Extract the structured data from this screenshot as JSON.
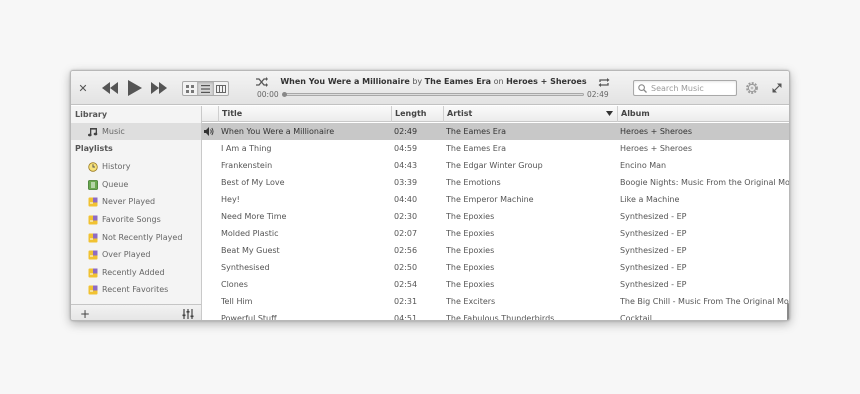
{
  "player": {
    "now_playing_title": "When You Were a Millionaire",
    "now_playing_by": "by",
    "now_playing_artist": "The Eames Era",
    "now_playing_on": "on",
    "now_playing_album": "Heroes + Sheroes",
    "time_elapsed": "00:00",
    "time_total": "02:49",
    "progress": 0.0
  },
  "search": {
    "placeholder": "Search Music",
    "value": ""
  },
  "sidebar": {
    "library_heading": "Library",
    "library_items": [
      {
        "label": "Music",
        "icon": "music-note-icon"
      }
    ],
    "playlists_heading": "Playlists",
    "playlist_items": [
      {
        "label": "History",
        "icon": "history-icon"
      },
      {
        "label": "Queue",
        "icon": "queue-icon"
      },
      {
        "label": "Never Played",
        "icon": "smart-playlist-icon"
      },
      {
        "label": "Favorite Songs",
        "icon": "smart-playlist-icon"
      },
      {
        "label": "Not Recently Played",
        "icon": "smart-playlist-icon"
      },
      {
        "label": "Over Played",
        "icon": "smart-playlist-icon"
      },
      {
        "label": "Recently Added",
        "icon": "smart-playlist-icon"
      },
      {
        "label": "Recent Favorites",
        "icon": "smart-playlist-icon"
      }
    ],
    "add_label": "+"
  },
  "table": {
    "columns": [
      "Title",
      "Length",
      "Artist",
      "Album"
    ],
    "sort_column": "Artist",
    "rows": [
      {
        "title": "When You Were a Millionaire",
        "length": "02:49",
        "artist": "The Eames Era",
        "album": "Heroes + Sheroes",
        "playing": true
      },
      {
        "title": "I Am a Thing",
        "length": "04:59",
        "artist": "The Eames Era",
        "album": "Heroes + Sheroes"
      },
      {
        "title": "Frankenstein",
        "length": "04:43",
        "artist": "The Edgar Winter Group",
        "album": "Encino Man"
      },
      {
        "title": "Best of My Love",
        "length": "03:39",
        "artist": "The Emotions",
        "album": "Boogie Nights: Music From the Original Motion"
      },
      {
        "title": "Hey!",
        "length": "04:40",
        "artist": "The Emperor Machine",
        "album": "Like a Machine"
      },
      {
        "title": "Need More Time",
        "length": "02:30",
        "artist": "The Epoxies",
        "album": "Synthesized - EP"
      },
      {
        "title": "Molded Plastic",
        "length": "02:07",
        "artist": "The Epoxies",
        "album": "Synthesized - EP"
      },
      {
        "title": "Beat My Guest",
        "length": "02:56",
        "artist": "The Epoxies",
        "album": "Synthesized - EP"
      },
      {
        "title": "Synthesised",
        "length": "02:50",
        "artist": "The Epoxies",
        "album": "Synthesized - EP"
      },
      {
        "title": "Clones",
        "length": "02:54",
        "artist": "The Epoxies",
        "album": "Synthesized - EP"
      },
      {
        "title": "Tell Him",
        "length": "02:31",
        "artist": "The Exciters",
        "album": "The Big Chill - Music From The Original Motion"
      },
      {
        "title": "Powerful Stuff",
        "length": "04:51",
        "artist": "The Fabulous Thunderbirds",
        "album": "Cocktail"
      }
    ]
  },
  "colors": {
    "selected_row": "#c8c8c8",
    "header_bg": "#e3e3e3",
    "sidebar_bg": "#f4f4f4",
    "smart_playlist_purple": "#7a5bb5",
    "smart_playlist_yellow": "#f1c232",
    "queue_green": "#6aa84f"
  }
}
